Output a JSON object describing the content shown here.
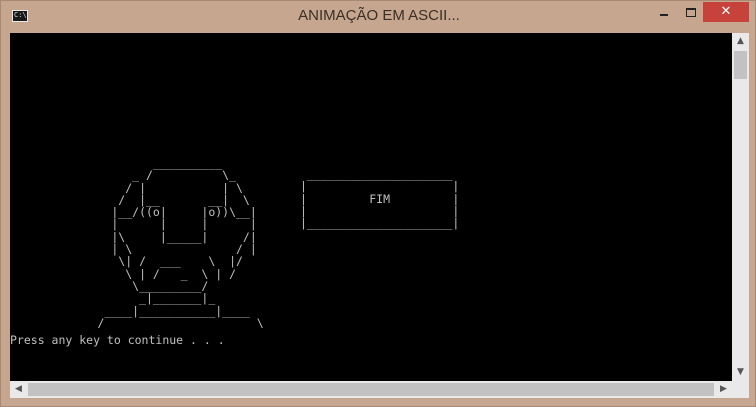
{
  "window": {
    "title": "ANIMAÇÃO EM ASCII...",
    "icon_text": "C:\\",
    "buttons": {
      "minimize": "minimize-icon",
      "maximize": "maximize-icon",
      "close": "✕"
    }
  },
  "console": {
    "screen_lines": [
      "              __________",
      "           _ /          \\_",
      "          / |           | \\",
      "         /  |__       __|  \\",
      "        |__/((o|     |o))\\__|",
      "        |      |     |      |",
      "        |\\     |_____|     /|",
      "        | \\               / |",
      "         \\| /  ___    \\  |/",
      "          \\ | /   _  \\ | /",
      "           \\_________/",
      "            _|_______|_",
      "       ____|___________|____",
      "      /                      \\"
    ],
    "box_lines": [
      " _____________________",
      "|                     |",
      "|         FIM         |",
      "|                     |",
      "|_____________________|"
    ],
    "prompt": "Press any key to continue . . ."
  },
  "scrollbars": {
    "vertical": {
      "up": "▲",
      "down": "▼"
    },
    "horizontal": {
      "left": "◀",
      "right": "▶"
    }
  },
  "colors": {
    "frame": "#c6a68e",
    "console_bg": "#000000",
    "console_text": "#c0c0c0",
    "close_button": "#c7423a"
  }
}
